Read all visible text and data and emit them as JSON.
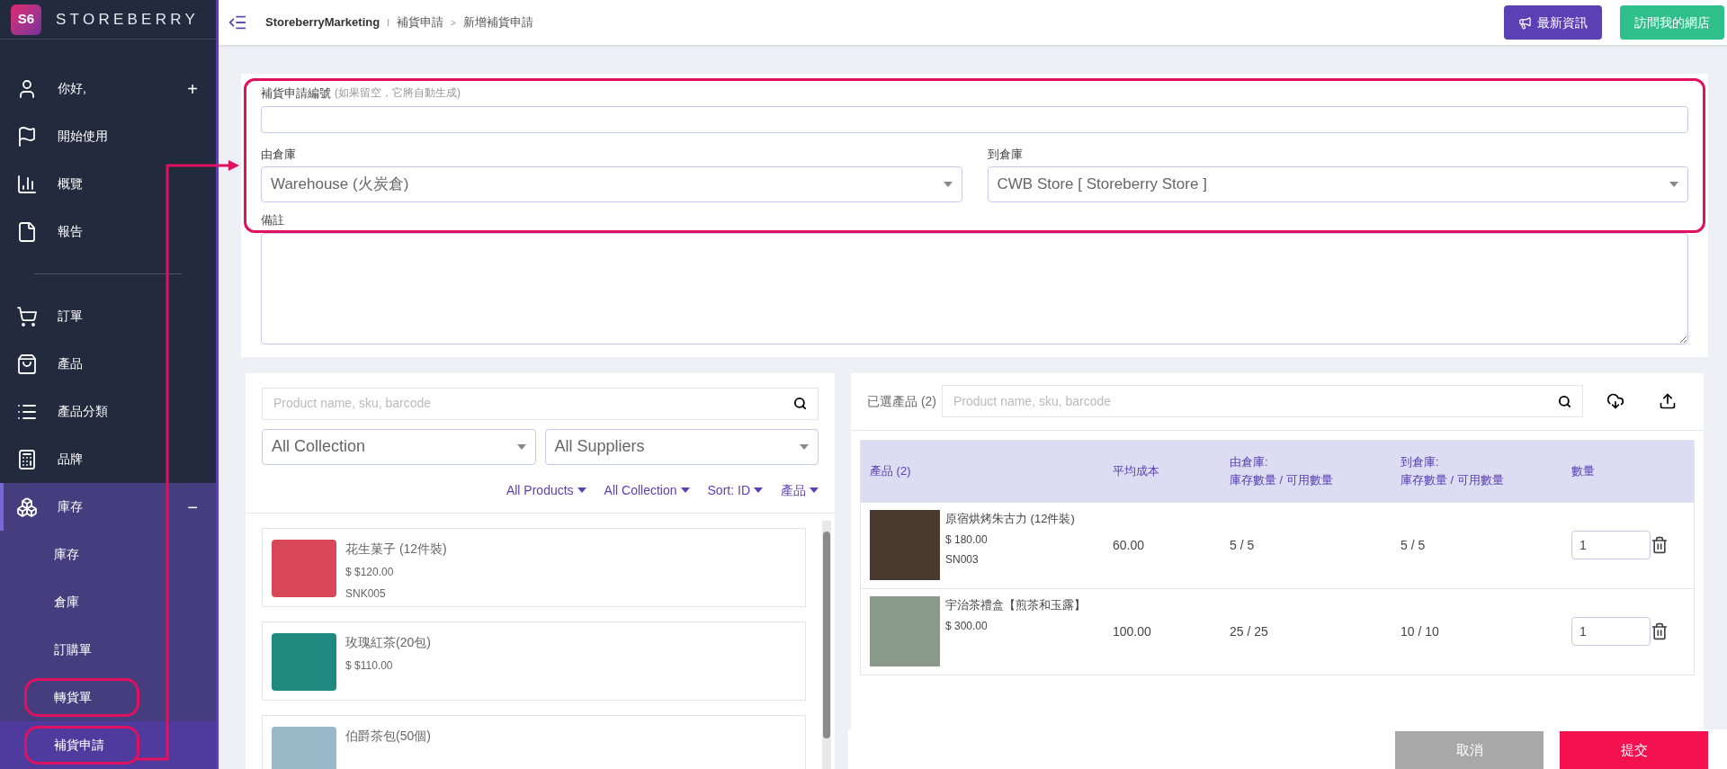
{
  "sidebar": {
    "brand": "STOREBERRY",
    "logo": "S6",
    "items": [
      {
        "label": "你好,",
        "toggle": "+",
        "expanded": false,
        "selected": false
      },
      {
        "label": "開始使用",
        "selected": false
      },
      {
        "label": "概覽",
        "selected": false
      },
      {
        "label": "報告",
        "selected": false
      },
      {
        "label": "訂單",
        "selected": false
      },
      {
        "label": "產品",
        "selected": false
      },
      {
        "label": "產品分類",
        "selected": false
      },
      {
        "label": "品牌",
        "selected": false
      },
      {
        "label": "庫存",
        "toggle": "−",
        "expanded": true,
        "selected": false,
        "children": [
          {
            "label": "庫存",
            "selected": false,
            "annotated": false
          },
          {
            "label": "倉庫",
            "selected": false,
            "annotated": false
          },
          {
            "label": "訂購單",
            "selected": false,
            "annotated": false
          },
          {
            "label": "轉貨單",
            "selected": false,
            "annotated": true
          },
          {
            "label": "補貨申請",
            "selected": true,
            "annotated": true
          }
        ]
      }
    ]
  },
  "topbar": {
    "breadcrumb": [
      "StoreberryMarketing",
      "補貨申請",
      "新增補貨申請"
    ],
    "separators": [
      "I",
      ">"
    ],
    "buttons": [
      "最新資訊",
      "訪問我的網店"
    ]
  },
  "form": {
    "annotated": true,
    "number_label": "補貨申請編號",
    "number_hint": "(如果留空，它將自動生成)",
    "from_label": "由倉庫",
    "from_value": "Warehouse (火炭倉)",
    "to_label": "到倉庫",
    "to_value": "CWB Store [ Storeberry Store ]",
    "notes_label": "備註"
  },
  "catalog": {
    "search_placeholder": "Product name, sku, barcode",
    "collection": "All Collection",
    "suppliers": "All Suppliers",
    "filters": [
      "All Products",
      "All Collection",
      "Sort: ID",
      "產品"
    ],
    "products": [
      {
        "name": "花生菓子 (12件裝)",
        "price": "$ $120.00",
        "sku": "SNK005"
      },
      {
        "name": "玫瑰紅茶(20包)",
        "price": "$ $110.00"
      },
      {
        "name": "伯爵茶包(50個)"
      }
    ]
  },
  "selected": {
    "label": "已選產品 (2)",
    "search_placeholder": "Product name, sku, barcode",
    "columns": [
      "產品 (2)",
      "平均成本",
      "由倉庫:\n庫存數量 / 可用數量",
      "到倉庫:\n庫存數量 / 可用數量",
      "數量"
    ],
    "rows": [
      {
        "name": "原宿烘烤朱古力 (12件裝)",
        "price": "$ 180.00",
        "sku": "SN003",
        "cost": "60.00",
        "from_stock": "5 / 5",
        "to_stock": "5 / 5",
        "qty": "1"
      },
      {
        "name": "宇治茶禮盒【煎茶和玉露】",
        "price": "$ 300.00",
        "cost": "100.00",
        "from_stock": "25 / 25",
        "to_stock": "10 / 10",
        "qty": "1"
      }
    ]
  },
  "actions": {
    "cancel": "取消",
    "submit": "提交"
  }
}
